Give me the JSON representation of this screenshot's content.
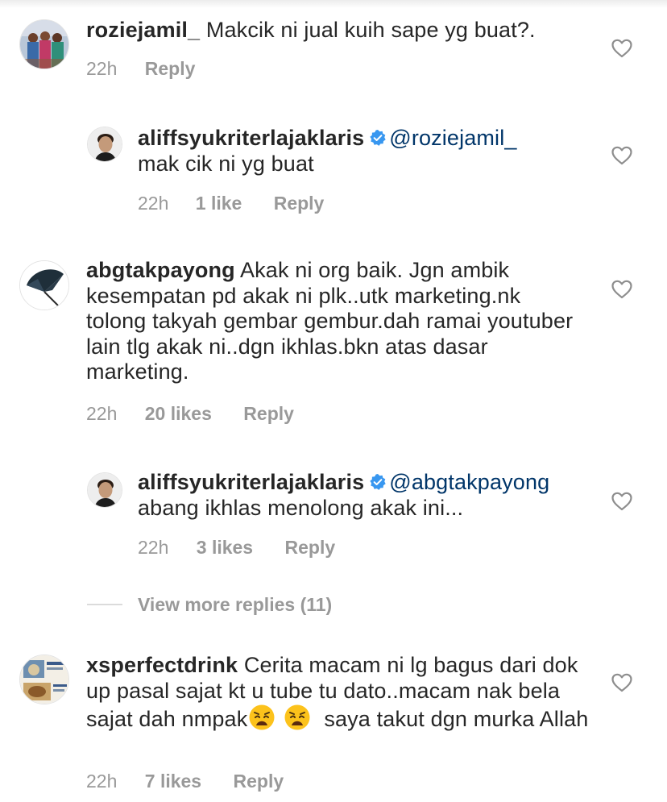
{
  "comments": [
    {
      "username": "roziejamil_",
      "text": "Makcik ni jual kuih sape yg buat?.",
      "time": "22h",
      "reply_label": "Reply"
    },
    {
      "username": "aliffsyukriterlajaklaris",
      "mention": "@roziejamil_",
      "text": "mak cik ni yg buat",
      "time": "22h",
      "likes": "1 like",
      "reply_label": "Reply"
    },
    {
      "username": "abgtakpayong",
      "text": "Akak ni org baik. Jgn ambik kesempatan pd akak ni plk..utk marketing.nk tolong takyah gembar gembur.dah ramai youtuber lain tlg akak ni..dgn ikhlas.bkn atas dasar marketing.",
      "time": "22h",
      "likes": "20 likes",
      "reply_label": "Reply"
    },
    {
      "username": "aliffsyukriterlajaklaris",
      "mention": "@abgtakpayong",
      "text": "abang ikhlas menolong akak ini...",
      "time": "22h",
      "likes": "3 likes",
      "reply_label": "Reply"
    },
    {
      "username": "xsperfectdrink",
      "text_before": "Cerita macam ni lg bagus dari dok up pasal sajat kt u tube tu dato..macam nak bela sajat dah nmpak",
      "emoji": "weary-face",
      "text_after": "saya takut dgn murka Allah",
      "time": "22h",
      "likes": "7 likes",
      "reply_label": "Reply"
    }
  ],
  "view_more_replies": "View more replies (11)",
  "icons": {
    "heart": "heart-outline-icon",
    "verified": "verified-badge-icon"
  },
  "colors": {
    "text": "#262626",
    "meta": "#999999",
    "mention": "#003569",
    "verified": "#3897f0",
    "heart_stroke": "#8e8e8e"
  }
}
